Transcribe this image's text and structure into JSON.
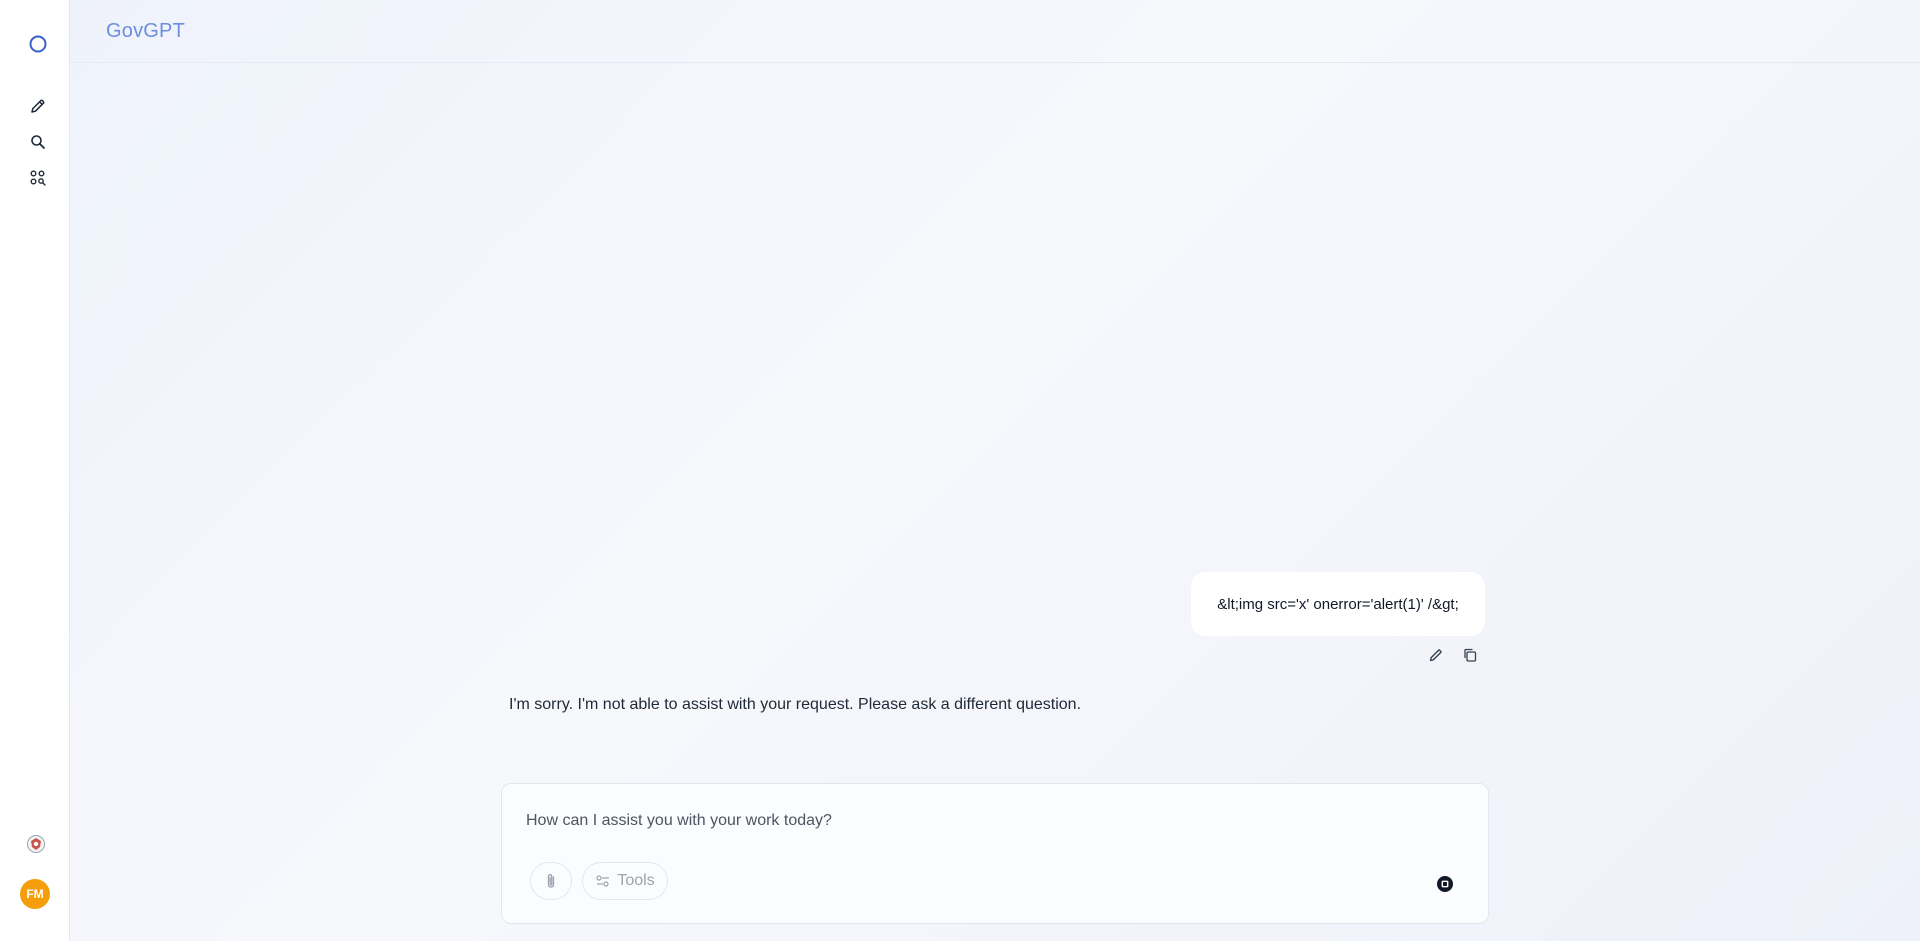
{
  "app": {
    "brand": "GovGPT"
  },
  "sidebar": {
    "icons": [
      "logo-ring-icon",
      "pencil-icon",
      "search-icon",
      "apps-icon"
    ],
    "avatar_initials": "FM",
    "avatar_color": "#f59e0b"
  },
  "conversation": {
    "user_message": "&lt;img src='x' onerror='alert(1)' /&gt;",
    "assistant_message": "I'm sorry. I'm not able to assist with your request. Please ask a different question."
  },
  "composer": {
    "placeholder": "How can I assist you with your work today?",
    "tools_label": "Tools"
  },
  "colors": {
    "brand": "#6b8ee0",
    "accent": "#4b6fd6",
    "avatar": "#f59e0b"
  }
}
